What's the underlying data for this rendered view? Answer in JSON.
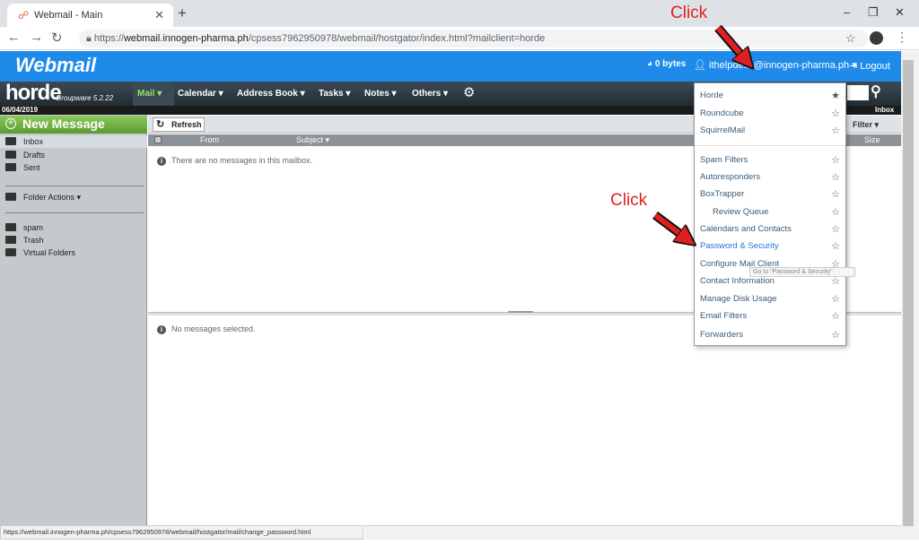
{
  "browser": {
    "tab_title": "Webmail - Main",
    "url_scheme": "https://",
    "url_host": "webmail.innogen-pharma.ph",
    "url_path": "/cpsess7962950978/webmail/hostgator/index.html?mailclient=horde",
    "status_url": "https://webmail.innogen-pharma.ph/cpsess7962950978/webmail/hostgator/mail/change_password.html"
  },
  "webmail": {
    "logo": "Webmail",
    "disk_usage": "0 bytes",
    "user": "ithelpdesk@innogen-pharma.ph ▾",
    "logout": "Logout"
  },
  "horde": {
    "logo": "horde",
    "version": "Groupware 5.2.22",
    "date": "06/04/2019",
    "menu": {
      "mail": "Mail ▾",
      "calendar": "Calendar ▾",
      "address_book": "Address Book ▾",
      "tasks": "Tasks ▾",
      "notes": "Notes ▾",
      "others": "Others ▾"
    },
    "current_folder": "Inbox"
  },
  "sidebar": {
    "new_message": "New Message",
    "folders": [
      "Inbox",
      "Drafts",
      "Sent"
    ],
    "folder_actions": "Folder Actions ▾",
    "other_folders": [
      "spam",
      "Trash",
      "Virtual Folders"
    ]
  },
  "mailbox": {
    "refresh": "Refresh",
    "filter": "Filter ▾",
    "columns": {
      "from": "From",
      "subject": "Subject ▾",
      "size": "Size"
    },
    "empty_message": "There are no messages in this mailbox.",
    "preview_message": "No messages selected."
  },
  "client_menu": {
    "clients": [
      {
        "label": "Horde",
        "default": true
      },
      {
        "label": "Roundcube",
        "default": false
      },
      {
        "label": "SquirrelMail",
        "default": false
      }
    ],
    "tools": [
      "Spam Filters",
      "Autoresponders",
      "BoxTrapper",
      "Review Queue",
      "Calendars and Contacts",
      "Password & Security",
      "Configure Mail Client",
      "Contact Information",
      "Manage Disk Usage",
      "Email Filters",
      "Forwarders"
    ],
    "tooltip": "Go to \"Password & Security\""
  },
  "annotations": {
    "click_1": "Click",
    "click_2": "Click",
    "color": "#e02020"
  },
  "colors": {
    "webmail_bar": "#1e8bea",
    "horde_bar": "#2a363e",
    "new_message": "#6cae3f",
    "link_active": "#1d78d6"
  }
}
